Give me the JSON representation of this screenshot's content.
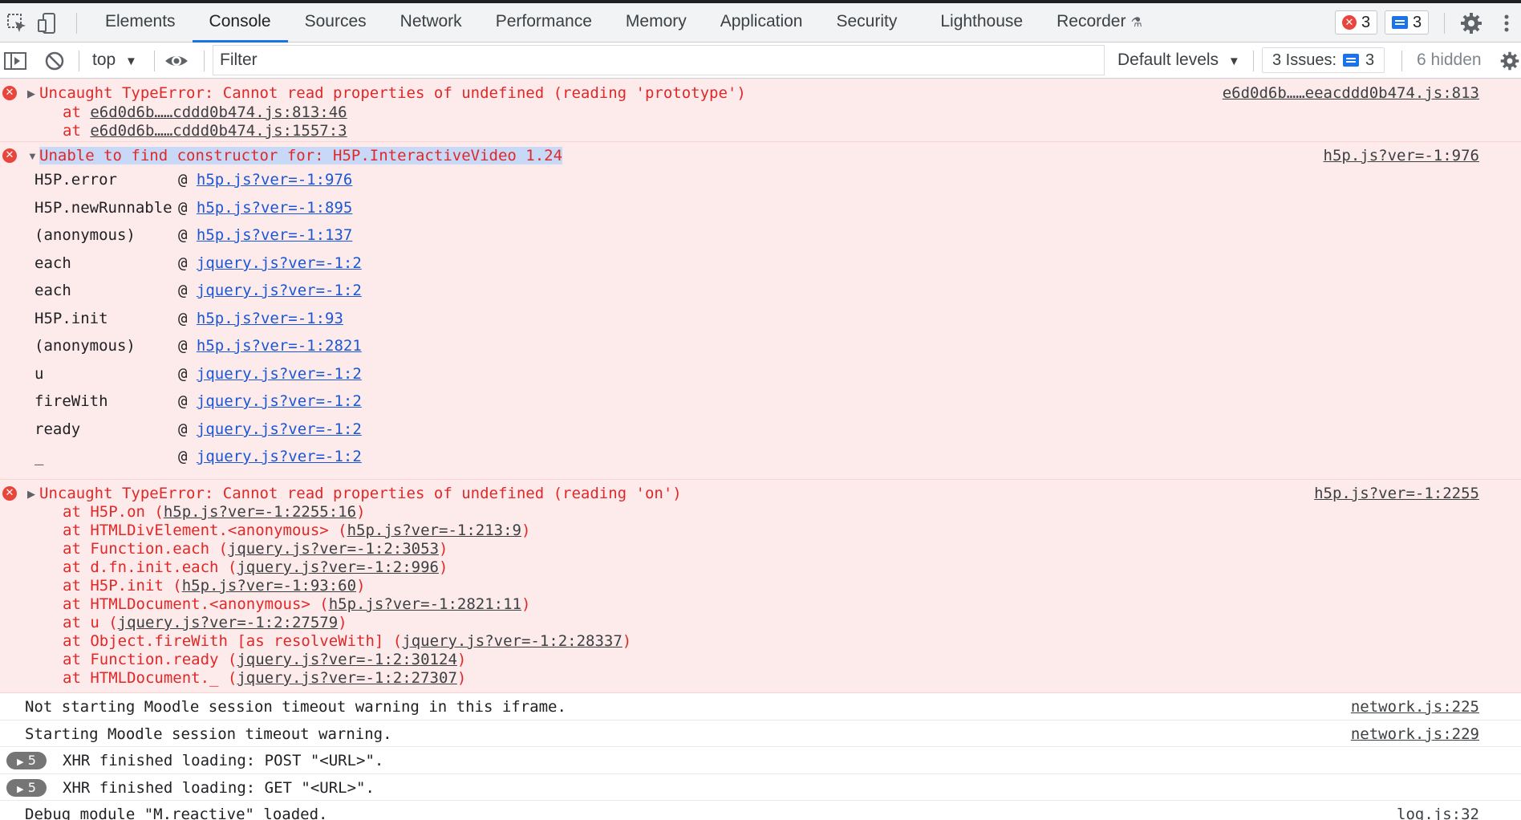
{
  "tabs": [
    "Elements",
    "Console",
    "Sources",
    "Network",
    "Performance",
    "Memory",
    "Application",
    "Security",
    "Lighthouse",
    "Recorder"
  ],
  "active_tab": "Console",
  "error_badge_count": "3",
  "message_badge_count": "3",
  "toolbar": {
    "context": "top",
    "filter_placeholder": "Filter",
    "levels": "Default levels",
    "issues_label": "3 Issues:",
    "issues_count": "3",
    "hidden": "6 hidden"
  },
  "messages": {
    "m1": {
      "text": "Uncaught TypeError: Cannot read properties of undefined (reading 'prototype')",
      "source": "e6d0d6b……eeacddd0b474.js:813",
      "stack": [
        {
          "prefix": "at ",
          "link": "e6d0d6b……cddd0b474.js:813:46"
        },
        {
          "prefix": "at ",
          "link": "e6d0d6b……cddd0b474.js:1557:3"
        }
      ]
    },
    "m2": {
      "text": "Unable to find constructor for: H5P.InteractiveVideo 1.24",
      "source": "h5p.js?ver=-1:976",
      "stack": [
        {
          "fn": "H5P.error",
          "link": "h5p.js?ver=-1:976"
        },
        {
          "fn": "H5P.newRunnable",
          "link": "h5p.js?ver=-1:895"
        },
        {
          "fn": "(anonymous)",
          "link": "h5p.js?ver=-1:137"
        },
        {
          "fn": "each",
          "link": "jquery.js?ver=-1:2"
        },
        {
          "fn": "each",
          "link": "jquery.js?ver=-1:2"
        },
        {
          "fn": "H5P.init",
          "link": "h5p.js?ver=-1:93"
        },
        {
          "fn": "(anonymous)",
          "link": "h5p.js?ver=-1:2821"
        },
        {
          "fn": "u",
          "link": "jquery.js?ver=-1:2"
        },
        {
          "fn": "fireWith",
          "link": "jquery.js?ver=-1:2"
        },
        {
          "fn": "ready",
          "link": "jquery.js?ver=-1:2"
        },
        {
          "fn": "_",
          "link": "jquery.js?ver=-1:2"
        }
      ]
    },
    "m3": {
      "text": "Uncaught TypeError: Cannot read properties of undefined (reading 'on')",
      "source": "h5p.js?ver=-1:2255",
      "stack": [
        {
          "prefix": "at H5P.on (",
          "link": "h5p.js?ver=-1:2255:16",
          "suffix": ")"
        },
        {
          "prefix": "at HTMLDivElement.<anonymous> (",
          "link": "h5p.js?ver=-1:213:9",
          "suffix": ")"
        },
        {
          "prefix": "at Function.each (",
          "link": "jquery.js?ver=-1:2:3053",
          "suffix": ")"
        },
        {
          "prefix": "at d.fn.init.each (",
          "link": "jquery.js?ver=-1:2:996",
          "suffix": ")"
        },
        {
          "prefix": "at H5P.init (",
          "link": "h5p.js?ver=-1:93:60",
          "suffix": ")"
        },
        {
          "prefix": "at HTMLDocument.<anonymous> (",
          "link": "h5p.js?ver=-1:2821:11",
          "suffix": ")"
        },
        {
          "prefix": "at u (",
          "link": "jquery.js?ver=-1:2:27579",
          "suffix": ")"
        },
        {
          "prefix": "at Object.fireWith [as resolveWith] (",
          "link": "jquery.js?ver=-1:2:28337",
          "suffix": ")"
        },
        {
          "prefix": "at Function.ready (",
          "link": "jquery.js?ver=-1:2:30124",
          "suffix": ")"
        },
        {
          "prefix": "at HTMLDocument._ (",
          "link": "jquery.js?ver=-1:2:27307",
          "suffix": ")"
        }
      ]
    },
    "m4": {
      "text": "Not starting Moodle session timeout warning in this iframe.",
      "source": "network.js:225"
    },
    "m5": {
      "text": "Starting Moodle session timeout warning.",
      "source": "network.js:229"
    },
    "m6": {
      "count": "5",
      "text": "XHR finished loading: POST \"<URL>\"."
    },
    "m7": {
      "count": "5",
      "text": "XHR finished loading: GET \"<URL>\"."
    },
    "m8": {
      "text": "Debug module \"M.reactive\" loaded.",
      "source": "log.js:32"
    }
  },
  "colors": {
    "error_text": "#e02828",
    "error_bg": "#fcebea",
    "accent": "#1a73e8",
    "link": "#1a56d6"
  }
}
